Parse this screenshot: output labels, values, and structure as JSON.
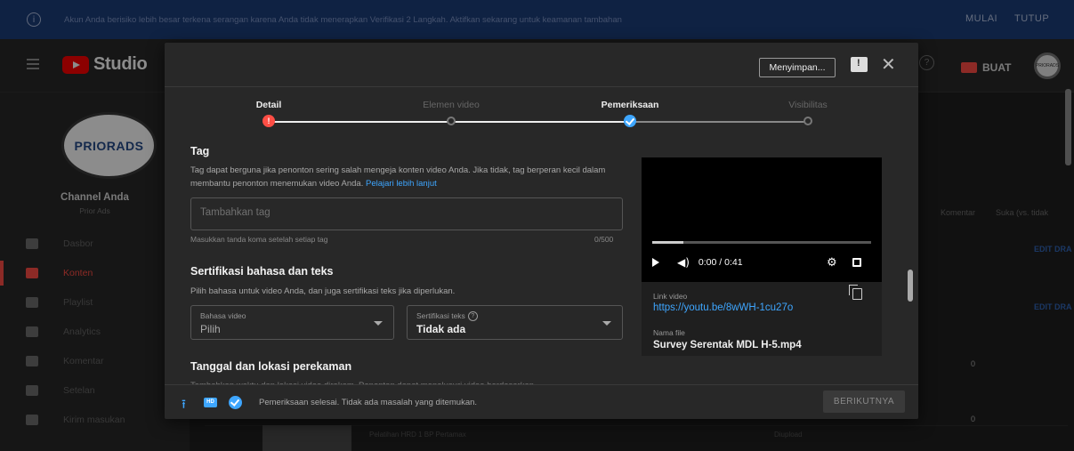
{
  "banner": {
    "message": "Akun Anda berisiko lebih besar terkena serangan karena Anda tidak menerapkan Verifikasi 2 Langkah. Aktifkan sekarang untuk keamanan tambahan",
    "start_label": "MULAI",
    "close_label": "TUTUP"
  },
  "header": {
    "app_name": "Studio",
    "create_label": "BUAT",
    "avatar_text": "PRIORADS"
  },
  "sidebar": {
    "channel_logo_text": "PRIORADS",
    "channel_title": "Channel Anda",
    "channel_name": "Prior Ads",
    "items": [
      {
        "label": "Dasbor",
        "icon": "dashboard-icon",
        "active": false
      },
      {
        "label": "Konten",
        "icon": "content-icon",
        "active": true
      },
      {
        "label": "Playlist",
        "icon": "playlist-icon",
        "active": false
      },
      {
        "label": "Analytics",
        "icon": "analytics-icon",
        "active": false
      },
      {
        "label": "Komentar",
        "icon": "comments-icon",
        "active": false
      },
      {
        "label": "Setelan",
        "icon": "settings-icon",
        "active": false
      },
      {
        "label": "Kirim masukan",
        "icon": "feedback-icon",
        "active": false
      }
    ]
  },
  "content_table": {
    "col_comments": "Komentar",
    "col_likes": "Suka (vs. tidak",
    "row1_edit": "EDIT DRA",
    "row2_edit": "EDIT DRA",
    "row3_comments": "0",
    "row4_comments": "0",
    "strip_title": "Pelatihan HRD 1 BP Pertamax",
    "strip_status": "Diupload"
  },
  "modal": {
    "saving_label": "Menyimpan...",
    "steps": [
      {
        "label": "Detail",
        "state": "error"
      },
      {
        "label": "Elemen video",
        "state": "pending"
      },
      {
        "label": "Pemeriksaan",
        "state": "done"
      },
      {
        "label": "Visibilitas",
        "state": "pending"
      }
    ],
    "tag": {
      "heading": "Tag",
      "description": "Tag dapat berguna jika penonton sering salah mengeja konten video Anda. Jika tidak, tag berperan kecil dalam membantu penonton menemukan video Anda.",
      "learn_more": "Pelajari lebih lanjut",
      "placeholder": "Tambahkan tag",
      "hint": "Masukkan tanda koma setelah setiap tag",
      "count": "0/500"
    },
    "cert": {
      "heading": "Sertifikasi bahasa dan teks",
      "description": "Pilih bahasa untuk video Anda, dan juga sertifikasi teks jika diperlukan.",
      "lang_label": "Bahasa video",
      "lang_value": "Pilih",
      "text_label": "Sertifikasi teks",
      "text_value": "Tidak ada"
    },
    "date": {
      "heading": "Tanggal dan lokasi perekaman",
      "description": "Tambahkan waktu dan lokasi video direkam. Penonton dapat menelusuri video berdasarkan"
    },
    "video": {
      "time": "0:00 / 0:41",
      "link_label": "Link video",
      "link": "https://youtu.be/8wWH-1cu27o",
      "file_label": "Nama file",
      "file_name": "Survey Serentak MDL H-5.mp4"
    },
    "footer": {
      "message": "Pemeriksaan selesai. Tidak ada masalah yang ditemukan.",
      "next_label": "BERIKUTNYA",
      "hd_text": "HD"
    }
  }
}
